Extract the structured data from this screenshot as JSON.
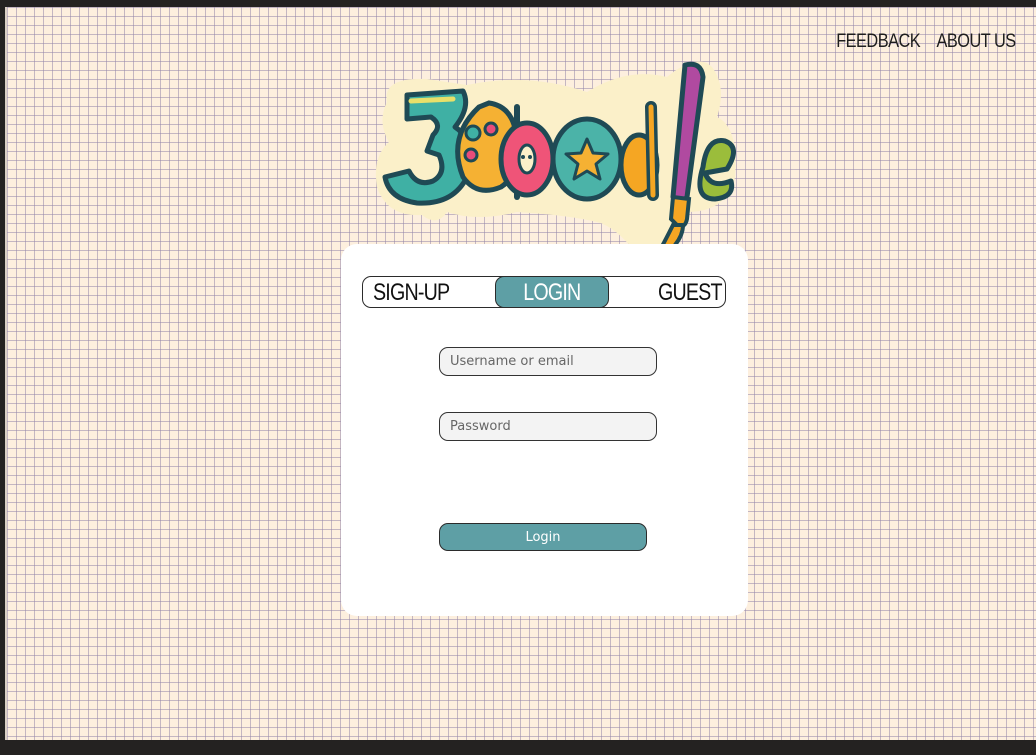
{
  "nav": {
    "feedback": "FEEDBACK",
    "about": "ABOUT US"
  },
  "logo": {
    "text": "3Doodle",
    "icon": "paint-brush-logo"
  },
  "tabs": {
    "signup": "SIGN-UP",
    "login": "LOGIN",
    "guest": "GUEST",
    "active": "LOGIN"
  },
  "form": {
    "username_placeholder": "Username or email",
    "password_placeholder": "Password",
    "submit_label": "Login"
  },
  "colors": {
    "accent": "#5e9fa5",
    "background": "#fdefde",
    "grid": "#9687aa",
    "frame": "#242221"
  }
}
